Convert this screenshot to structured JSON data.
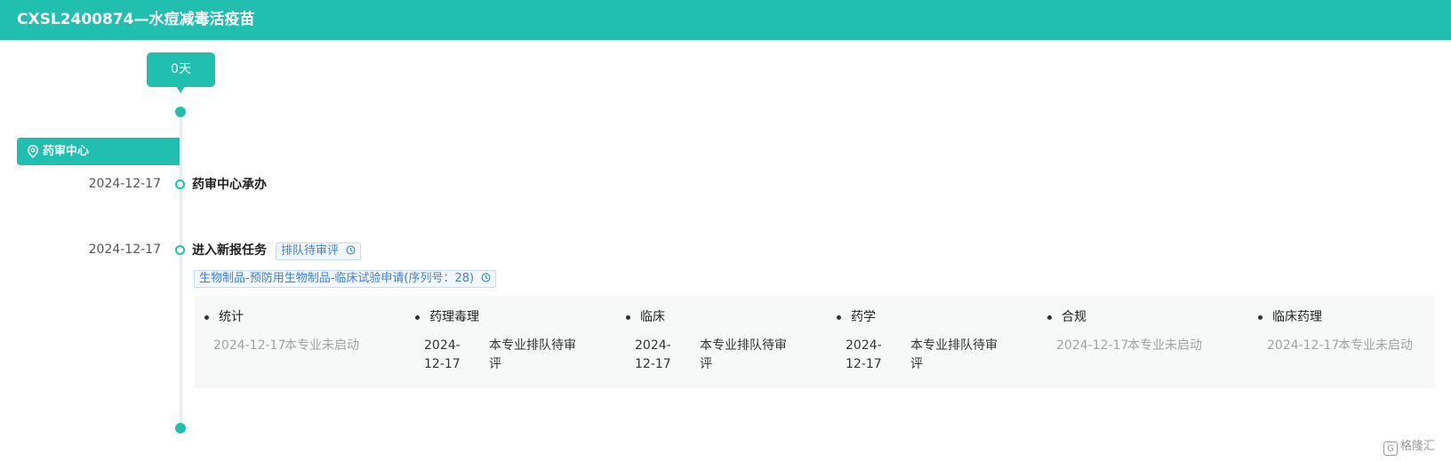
{
  "header": {
    "title": "CXSL2400874—水痘减毒活疫苗"
  },
  "timeline": {
    "days_label": "0天",
    "center": {
      "icon": "location-pin-icon",
      "label": "药审中心"
    },
    "events": [
      {
        "date": "2024-12-17",
        "title": "药审中心承办"
      },
      {
        "date": "2024-12-17",
        "title": "进入新报任务",
        "status_tag": {
          "label": "排队待审评",
          "icon": "clock-icon"
        },
        "category_tag": {
          "label": "生物制品-预防用生物制品-临床试验申请(序列号：28)",
          "icon": "clock-icon"
        },
        "reviews": [
          {
            "name": "统计",
            "date": "2024-12-17",
            "status": "本专业未启动"
          },
          {
            "name": "药理毒理",
            "date": "2024-12-17",
            "status": "本专业排队待审评"
          },
          {
            "name": "临床",
            "date": "2024-12-17",
            "status": "本专业排队待审评"
          },
          {
            "name": "药学",
            "date": "2024-12-17",
            "status": "本专业排队待审评"
          },
          {
            "name": "合规",
            "date": "2024-12-17",
            "status": "本专业未启动"
          },
          {
            "name": "临床药理",
            "date": "2024-12-17",
            "status": "本专业未启动"
          }
        ]
      }
    ]
  },
  "colors": {
    "accent": "#20bfb0",
    "tag_text": "#3f7fd1",
    "muted_text": "#a3a3a3",
    "panel_bg": "#f7f8f8"
  },
  "watermark": {
    "icon": "brand-logo-icon",
    "text": "格隆汇"
  }
}
